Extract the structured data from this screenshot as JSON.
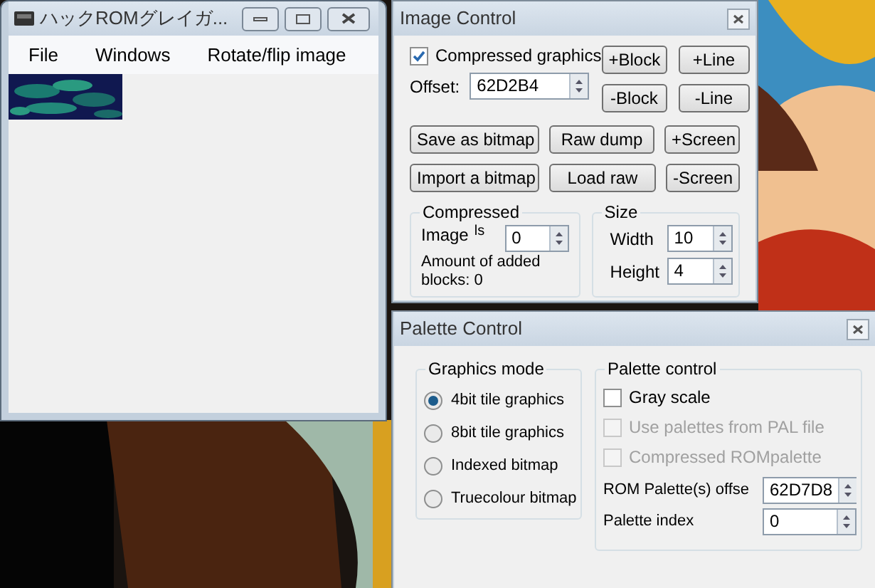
{
  "main_window": {
    "title": "ハックROMグレイガ...",
    "menu": [
      "File",
      "Windows",
      "Rotate/flip image"
    ],
    "image": {
      "kind": "picture"
    }
  },
  "image_control": {
    "title": "Image Control",
    "compressed": {
      "label": "Compressed graphics",
      "checked": true
    },
    "offset": {
      "label": "Offset:",
      "value": "62D2B4"
    },
    "block_buttons": [
      [
        "+Block",
        "+Line"
      ],
      [
        "-Block",
        "-Line"
      ]
    ],
    "action_buttons": [
      [
        "Save as bitmap",
        "Raw dump",
        "+Screen"
      ],
      [
        "Import a bitmap",
        "Load raw",
        "-Screen"
      ]
    ],
    "compressed_group": {
      "title": "Compressed",
      "label": "Image",
      "label_overflow": "ls",
      "value": "0",
      "note": "Amount of added blocks: 0"
    },
    "size_group": {
      "title": "Size",
      "fields": [
        {
          "label": "Width",
          "value": "10"
        },
        {
          "label": "Height",
          "value": "4"
        }
      ]
    }
  },
  "palette_control": {
    "title": "Palette Control",
    "graphics_mode": {
      "title": "Graphics mode",
      "options": [
        {
          "label": "4bit tile graphics",
          "selected": true
        },
        {
          "label": "8bit tile graphics",
          "selected": false
        },
        {
          "label": "Indexed bitmap",
          "selected": false
        },
        {
          "label": "Truecolour bitmap",
          "selected": false
        }
      ]
    },
    "palette": {
      "title": "Palette control",
      "checkboxes": [
        {
          "label": "Gray scale",
          "checked": false,
          "disabled": false
        },
        {
          "label": "Use palettes from PAL file",
          "checked": false,
          "disabled": true
        },
        {
          "label": "Compressed ROMpalette",
          "checked": false,
          "disabled": true
        }
      ],
      "fields": [
        {
          "label": "ROM Palette(s) offse",
          "value": "62D7D8"
        },
        {
          "label": "Palette index",
          "value": "0"
        }
      ]
    }
  }
}
